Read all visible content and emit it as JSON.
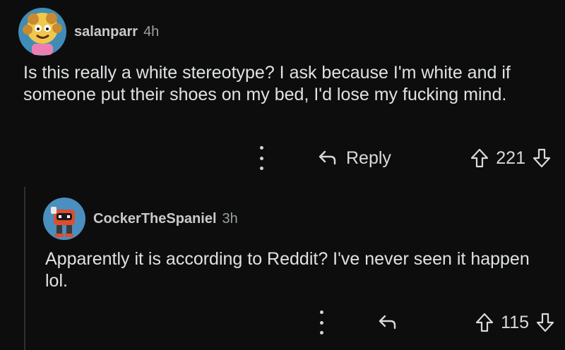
{
  "comments": [
    {
      "author": "salanparr",
      "age": "4h",
      "body": "Is this really a white stereotype? I ask because I'm white and if someone put their shoes on my bed, I'd lose my fucking mind.",
      "reply_label": "Reply",
      "score": "221"
    },
    {
      "author": "CockerTheSpaniel",
      "age": "3h",
      "body": "Apparently it is according to Reddit? I've never seen it happen lol.",
      "score": "115"
    }
  ],
  "icons": {
    "more": "kebab-vertical",
    "reply": "reply-arrow",
    "upvote": "upvote-arrow",
    "downvote": "downvote-arrow"
  },
  "colors": {
    "background": "#0d0d0d",
    "text": "#d7dadc",
    "muted": "#9aa0a3"
  }
}
